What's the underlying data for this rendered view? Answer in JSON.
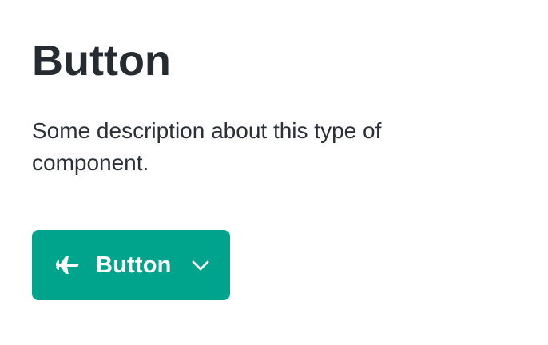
{
  "heading": {
    "title": "Button",
    "description": "Some description about this type of component."
  },
  "button": {
    "label": "Button",
    "leading_icon": "airplane-icon",
    "trailing_icon": "chevron-down-icon",
    "background_color": "#00a38b",
    "text_color": "#ffffff"
  }
}
